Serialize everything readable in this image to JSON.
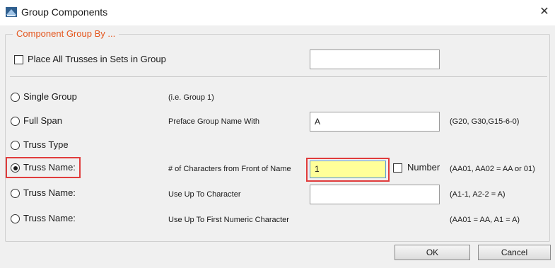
{
  "window": {
    "title": "Group Components"
  },
  "group": {
    "legend": "Component Group By ..."
  },
  "place_all": {
    "label": "Place All Trusses in Sets in Group",
    "value": ""
  },
  "options": [
    {
      "label": "Single Group",
      "field_label": "(i.e. Group 1)",
      "example": ""
    },
    {
      "label": "Full Span",
      "field_label": "Preface Group Name With",
      "value": "A",
      "example": "(G20, G30,G15-6-0)"
    },
    {
      "label": "Truss Type",
      "field_label": "",
      "example": ""
    },
    {
      "label": "Truss Name:",
      "field_label": "# of Characters from Front of Name",
      "value": "1",
      "number_label": "Number",
      "example": "(AA01, AA02 = AA or 01)"
    },
    {
      "label": "Truss Name:",
      "field_label": "Use Up To Character",
      "value": "",
      "example": "(A1-1, A2-2 = A)"
    },
    {
      "label": "Truss Name:",
      "field_label": "Use Up To First Numeric Character",
      "example": "(AA01 = AA, A1 = A)"
    }
  ],
  "buttons": {
    "ok": "OK",
    "cancel": "Cancel"
  },
  "colors": {
    "legend": "#e4561e",
    "highlight": "#e03c3c",
    "active_field": "#ffff99"
  },
  "selected_option_index": 3
}
